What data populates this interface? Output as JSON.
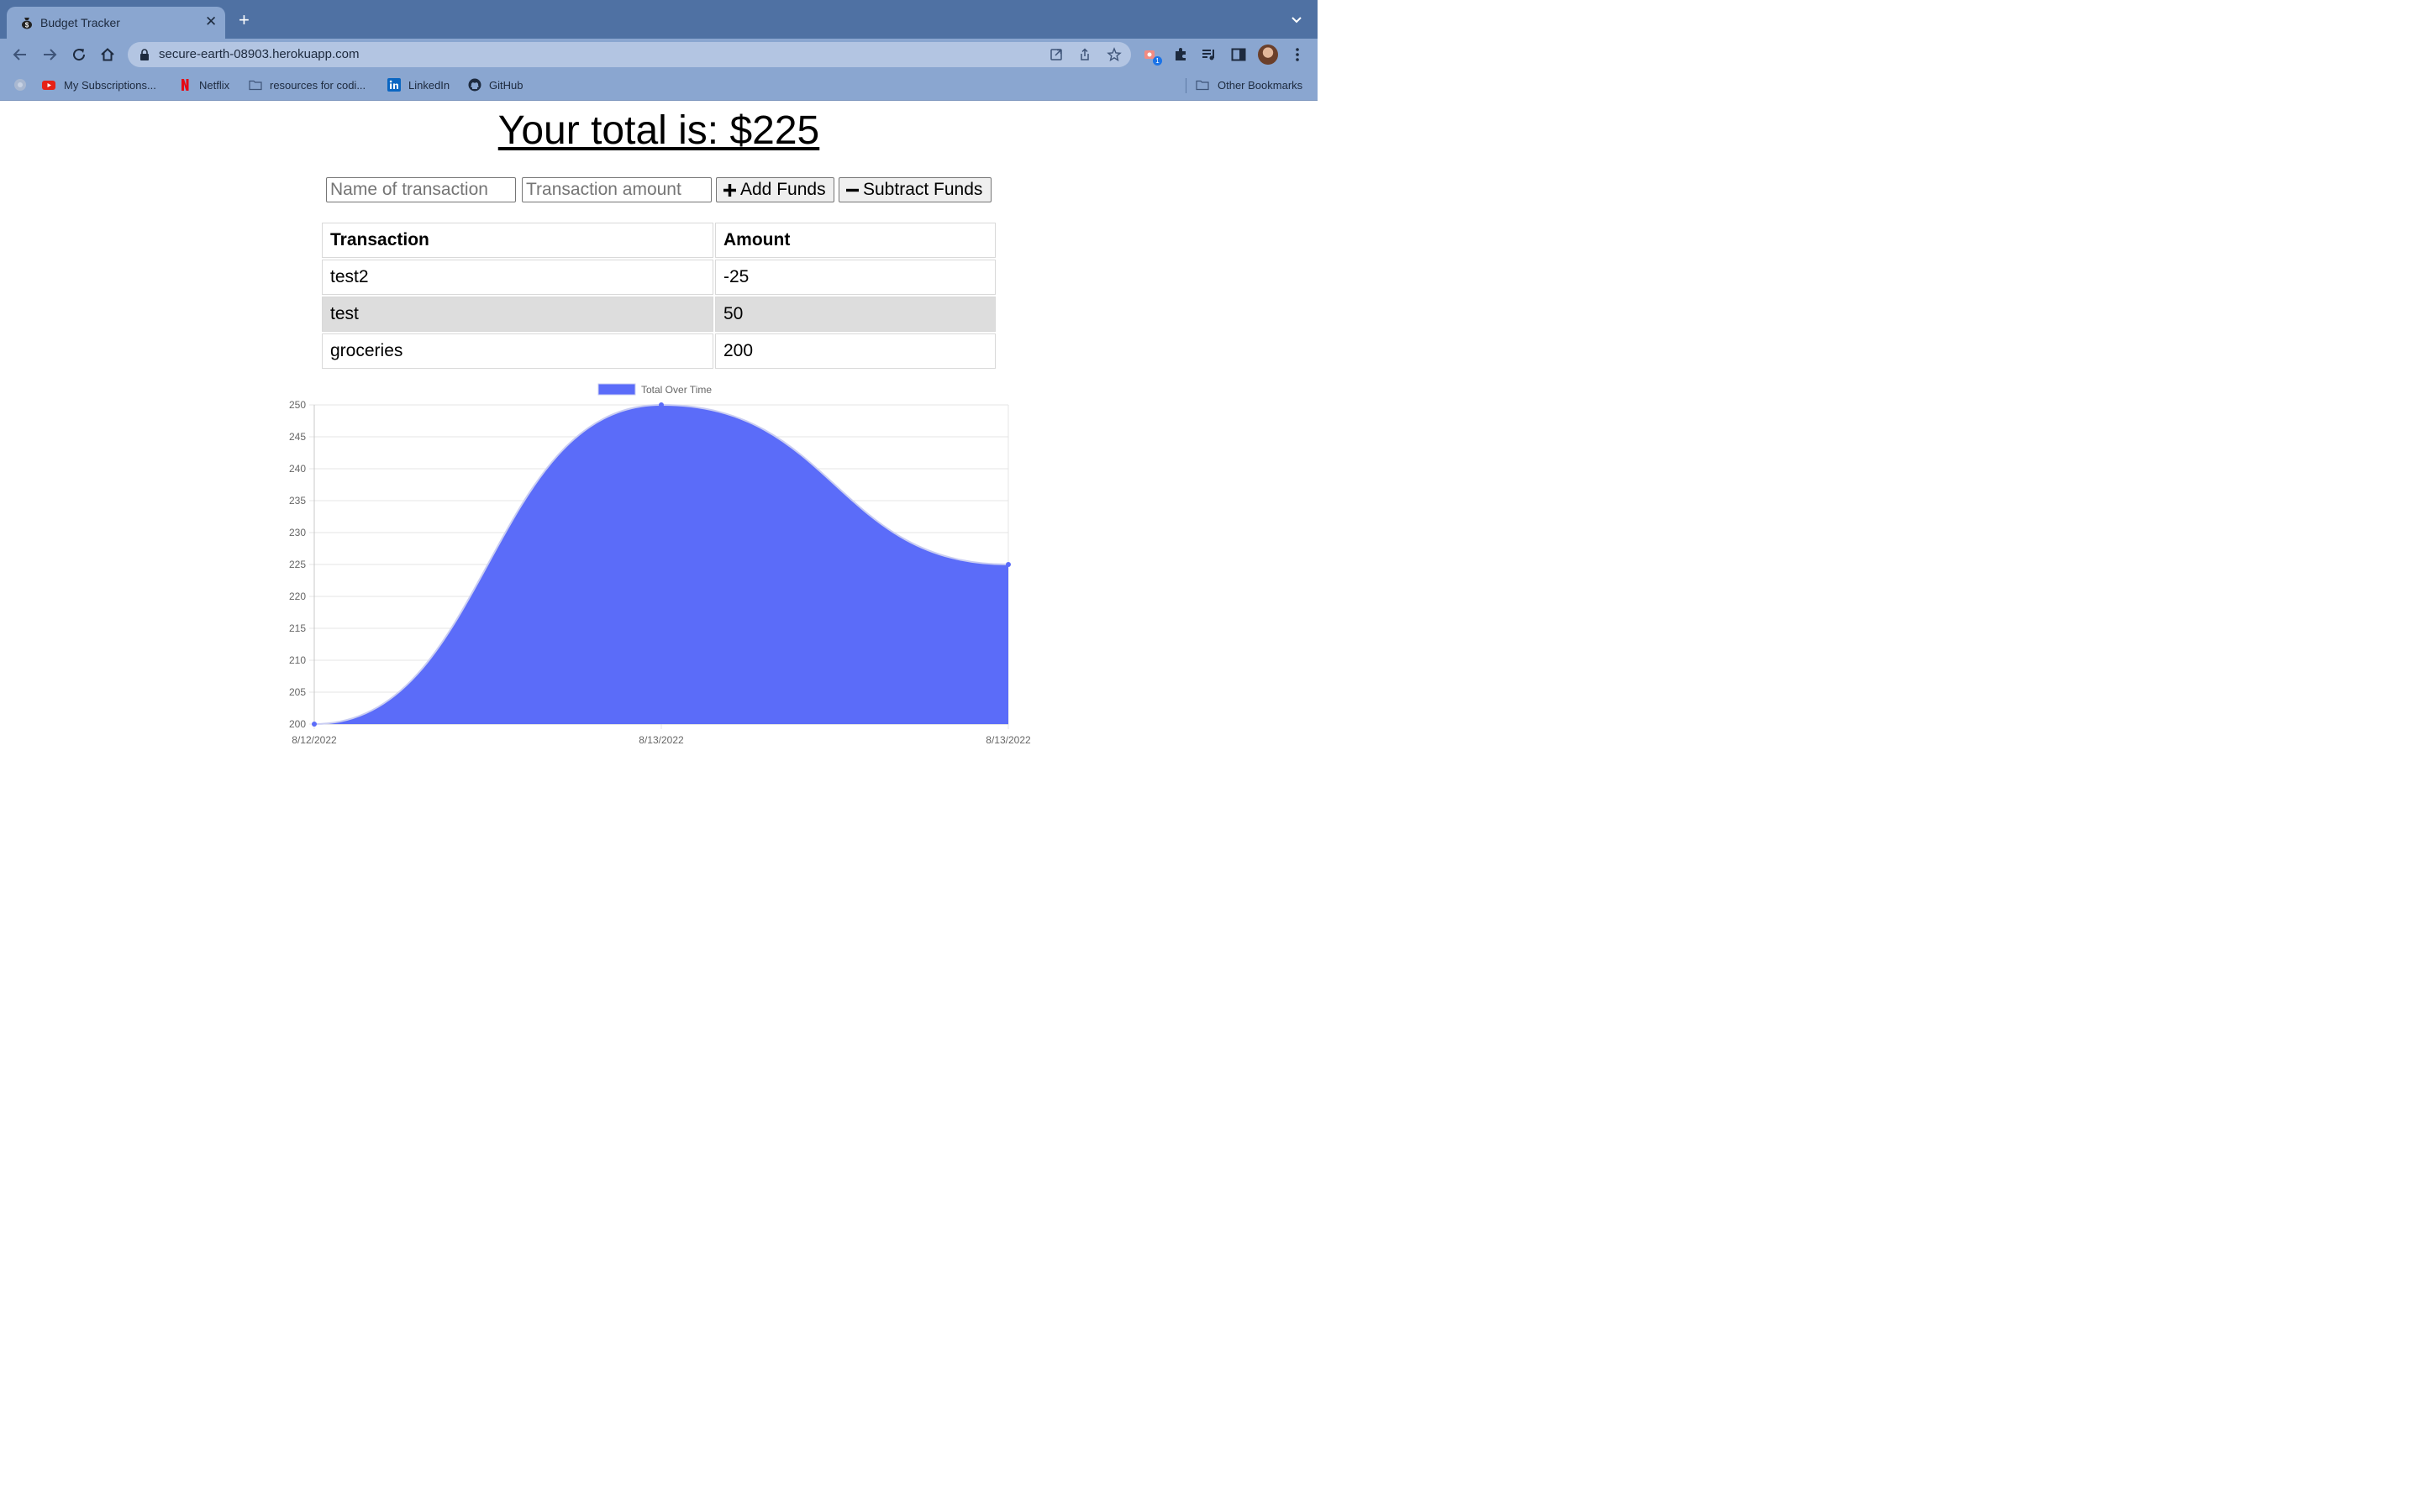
{
  "browser": {
    "tab_title": "Budget Tracker",
    "url": "secure-earth-08903.herokuapp.com",
    "extension_badge": "1",
    "bookmarks": [
      {
        "label": "My Subscriptions..."
      },
      {
        "label": "Netflix"
      },
      {
        "label": "resources for codi..."
      },
      {
        "label": "LinkedIn"
      },
      {
        "label": "GitHub"
      }
    ],
    "other_bookmarks": "Other Bookmarks"
  },
  "page": {
    "total_text": "Your total is: $225",
    "name_placeholder": "Name of transaction",
    "amount_placeholder": "Transaction amount",
    "add_label": "Add Funds",
    "subtract_label": "Subtract Funds",
    "table": {
      "headers": [
        "Transaction",
        "Amount"
      ],
      "rows": [
        [
          "test2",
          "-25"
        ],
        [
          "test",
          "50"
        ],
        [
          "groceries",
          "200"
        ]
      ]
    }
  },
  "colors": {
    "chart_fill": "#5b6cf9",
    "chart_line": "#c9cdf2",
    "tab_strip": "#4f71a3",
    "toolbar": "#8aa6d0"
  },
  "chart_data": {
    "type": "area",
    "x": [
      "8/12/2022",
      "8/13/2022",
      "8/13/2022"
    ],
    "series": [
      {
        "name": "Total Over Time",
        "values": [
          200,
          250,
          225
        ]
      }
    ],
    "ylim": [
      200,
      250
    ],
    "yticks": [
      200,
      205,
      210,
      215,
      220,
      225,
      230,
      235,
      240,
      245,
      250
    ],
    "legend": "top-center",
    "grid": true
  }
}
